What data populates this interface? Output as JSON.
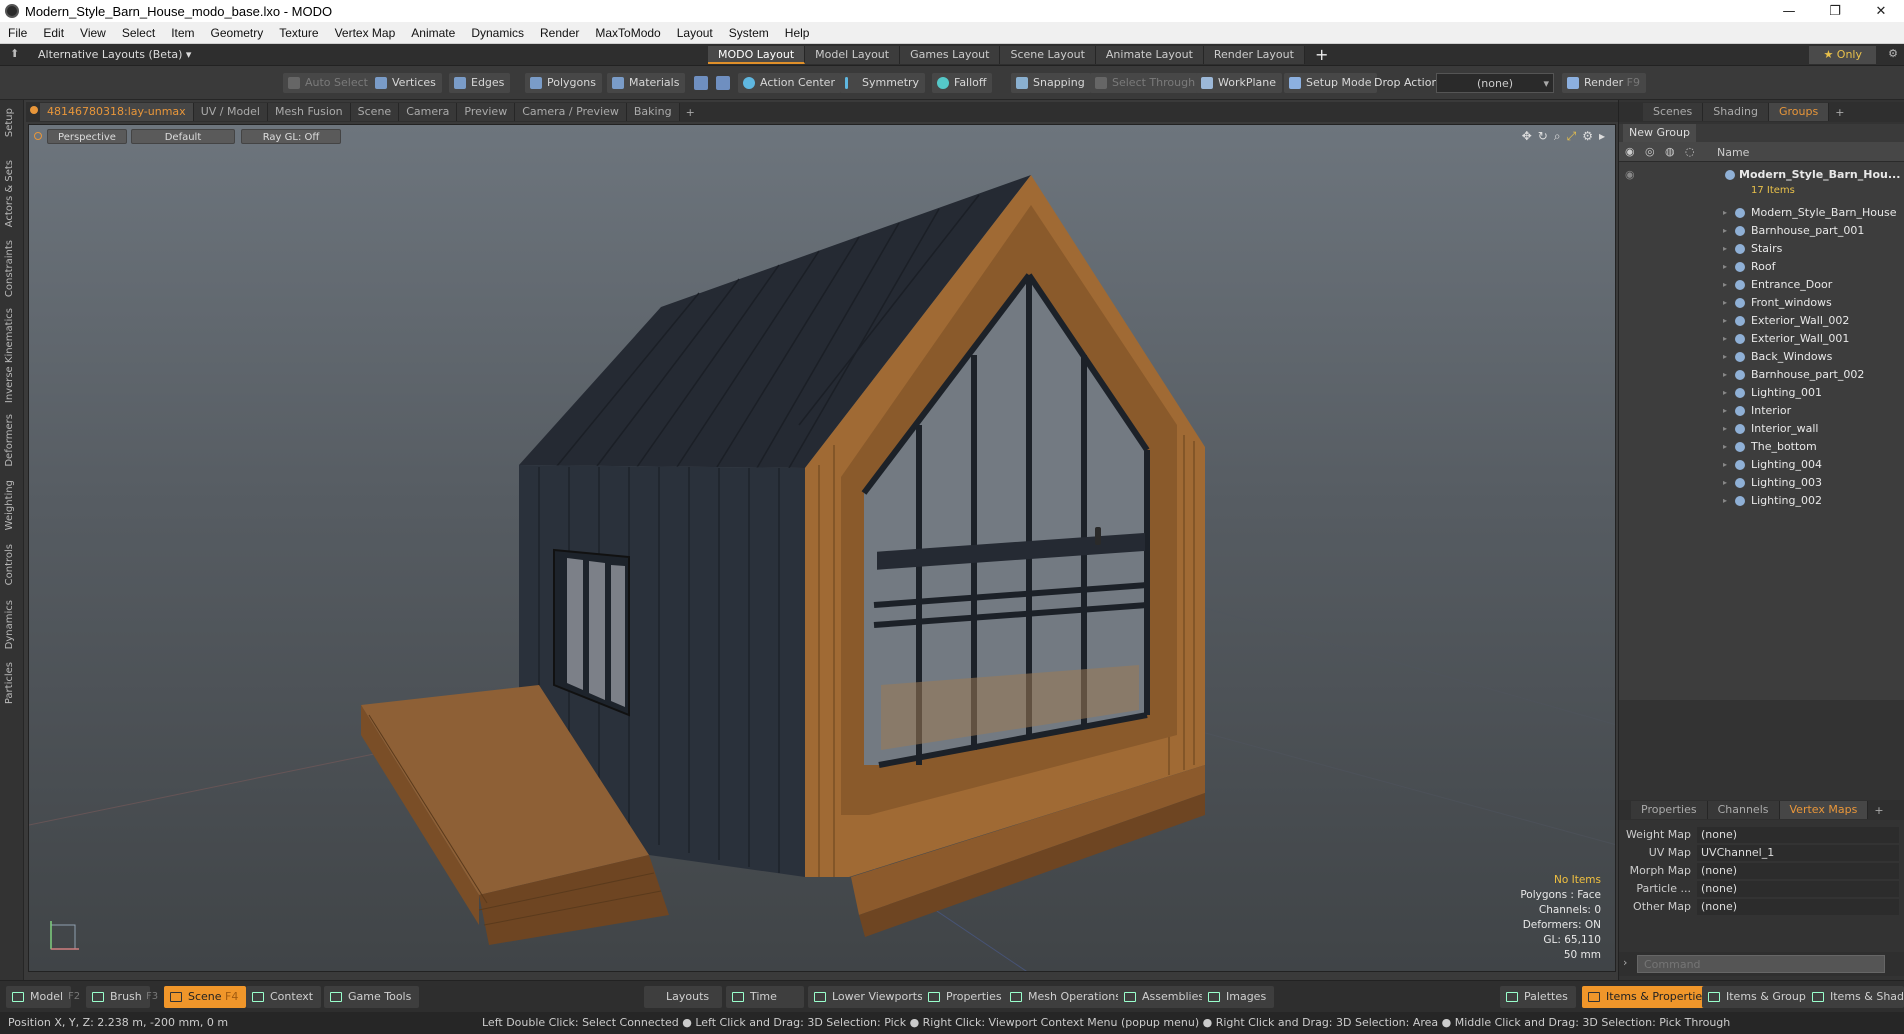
{
  "window": {
    "title": "Modern_Style_Barn_House_modo_base.lxo - MODO"
  },
  "menu": [
    "File",
    "Edit",
    "View",
    "Select",
    "Item",
    "Geometry",
    "Texture",
    "Vertex Map",
    "Animate",
    "Dynamics",
    "Render",
    "MaxToModo",
    "Layout",
    "System",
    "Help"
  ],
  "layoutbar": {
    "alt_layouts": "Alternative Layouts (Beta) ▾",
    "tabs": [
      "MODO Layout",
      "Model Layout",
      "Games Layout",
      "Scene Layout",
      "Animate Layout",
      "Render Layout"
    ],
    "only_label": "★ Only"
  },
  "toolbar": {
    "auto_select": "Auto Select",
    "vertices": "Vertices",
    "edges": "Edges",
    "polygons": "Polygons",
    "materials": "Materials",
    "action_center": "Action Center",
    "symmetry": "Symmetry",
    "falloff": "Falloff",
    "snapping": "Snapping",
    "select_through": "Select Through",
    "workplane": "WorkPlane",
    "setup_mode": "Setup Mode",
    "drop_action": "Drop Action",
    "drop_action_value": "(none)",
    "render": "Render",
    "render_key": "F9"
  },
  "left_tabs": [
    "Setup",
    "Actors & Sets",
    "Constraints",
    "Inverse Kinematics",
    "Deformers",
    "Weighting",
    "Controls",
    "Dynamics",
    "Particles"
  ],
  "viewport_tabs": [
    "48146780318:lay-unmax",
    "UV / Model",
    "Mesh Fusion",
    "Scene",
    "Camera",
    "Preview",
    "Camera / Preview",
    "Baking"
  ],
  "viewport": {
    "view_mode": "Perspective",
    "shading": "Default",
    "raygl": "Ray GL: Off",
    "stats": {
      "items": "No Items",
      "polygons": "Polygons : Face",
      "channels": "Channels: 0",
      "deformers": "Deformers: ON",
      "gl": "GL: 65,110",
      "focal": "50 mm"
    }
  },
  "right_panel": {
    "top_tabs": [
      "Scenes",
      "Shading",
      "Groups"
    ],
    "new_group": "New Group",
    "name_header": "Name",
    "root": {
      "name": "Modern_Style_Barn_Hou...",
      "count": "17 Items"
    },
    "items": [
      "Modern_Style_Barn_House",
      "Barnhouse_part_001",
      "Stairs",
      "Roof",
      "Entrance_Door",
      "Front_windows",
      "Exterior_Wall_002",
      "Exterior_Wall_001",
      "Back_Windows",
      "Barnhouse_part_002",
      "Lighting_001",
      "Interior",
      "Interior_wall",
      "The_bottom",
      "Lighting_004",
      "Lighting_003",
      "Lighting_002"
    ],
    "bottom_tabs": [
      "Properties",
      "Channels",
      "Vertex Maps"
    ],
    "vertex_maps": [
      {
        "k": "Weight Map",
        "v": "(none)"
      },
      {
        "k": "UV Map",
        "v": "UVChannel_1"
      },
      {
        "k": "Morph Map",
        "v": "(none)"
      },
      {
        "k": "Particle ...",
        "v": "(none)"
      },
      {
        "k": "Other Map",
        "v": "(none)"
      }
    ],
    "command_placeholder": "Command"
  },
  "bottom_bar": {
    "model": "Model",
    "f2": "F2",
    "brush": "Brush",
    "f3": "F3",
    "scene": "Scene",
    "f4": "F4",
    "context": "Context",
    "game_tools": "Game Tools",
    "layouts": "Layouts",
    "time": "Time",
    "lower_viewports": "Lower Viewports",
    "properties": "Properties",
    "mesh_operations": "Mesh Operations",
    "assemblies": "Assemblies",
    "images": "Images",
    "palettes": "Palettes",
    "items_properties": "Items & Properties",
    "items_groups": "Items & Groups",
    "items_shading": "Items & Shading"
  },
  "status": {
    "position": "Position X, Y, Z:   2.238 m, -200 mm, 0 m",
    "hints": "Left Double Click: Select Connected ● Left Click and Drag: 3D Selection: Pick ● Right Click: Viewport Context Menu (popup menu) ● Right Click and Drag: 3D Selection: Area ● Middle Click and Drag: 3D Selection: Pick Through"
  }
}
